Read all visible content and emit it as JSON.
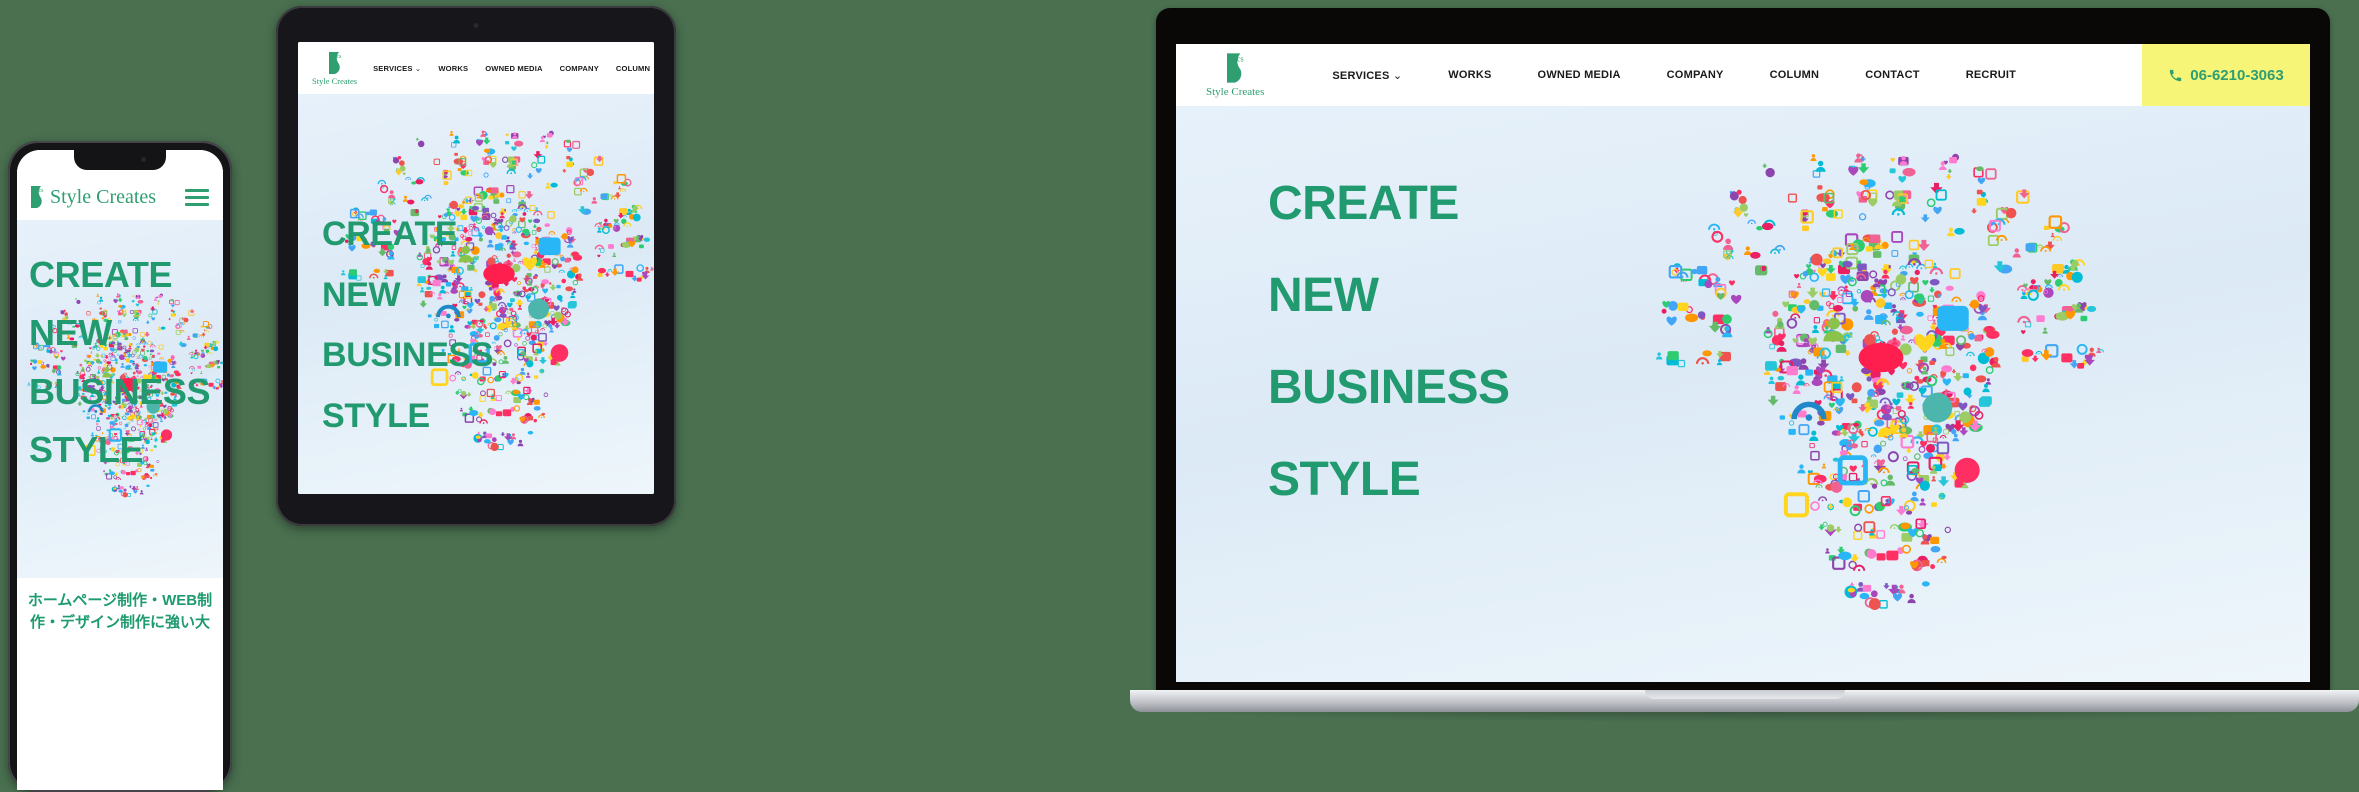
{
  "brand": {
    "name": "Style Creates",
    "logo_mark_text": "cs",
    "accent_green": "#2f9e71",
    "hero_green": "#229a70",
    "tel_bg": "#f6f578",
    "page_bg": "#4a7050"
  },
  "nav": {
    "items": [
      {
        "label": "SERVICES",
        "has_dropdown": true,
        "caret": "⌄"
      },
      {
        "label": "WORKS",
        "has_dropdown": false,
        "caret": ""
      },
      {
        "label": "OWNED MEDIA",
        "has_dropdown": false,
        "caret": ""
      },
      {
        "label": "COMPANY",
        "has_dropdown": false,
        "caret": ""
      },
      {
        "label": "COLUMN",
        "has_dropdown": false,
        "caret": ""
      },
      {
        "label": "CONTACT",
        "has_dropdown": false,
        "caret": ""
      },
      {
        "label": "RECRUIT",
        "has_dropdown": false,
        "caret": ""
      }
    ],
    "phone": "06-6210-3063",
    "phone_icon": "phone-icon",
    "menu_icon": "hamburger-menu-icon"
  },
  "hero": {
    "lines": [
      "CREATE",
      "NEW",
      "BUSINESS",
      "STYLE"
    ],
    "graphic": "lightbulb-icon-collage"
  },
  "mobile": {
    "tagline_lines": [
      "ホームページ制作・WEB制",
      "作・デザイン制作に強い大"
    ]
  },
  "devices": [
    {
      "name": "smartphone",
      "label": "phone-mockup"
    },
    {
      "name": "tablet",
      "label": "tablet-mockup"
    },
    {
      "name": "laptop",
      "label": "laptop-mockup"
    }
  ]
}
